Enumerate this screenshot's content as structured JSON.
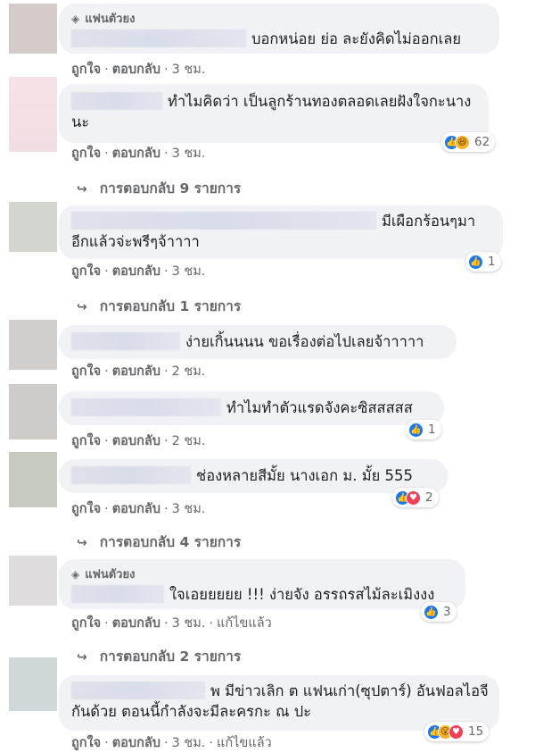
{
  "comments": [
    {
      "badge": "แฟนตัวยง",
      "text": "บอกหน่อย ย่อ ละยังคิดไม่ออกเลย",
      "actions": {
        "like": "ถูกใจ",
        "reply": "ตอบกลับ",
        "time": "3 ชม."
      }
    },
    {
      "text": "ทำไมคิดว่า เป็นลูกร้านทองตลอดเลยฝังใจกะนางนะ",
      "actions": {
        "like": "ถูกใจ",
        "reply": "ตอบกลับ",
        "time": "3 ชม."
      },
      "reactions": {
        "icons": [
          "like-icon",
          "haha-icon"
        ],
        "count": "62"
      },
      "replies": "การตอบกลับ 9 รายการ"
    },
    {
      "text": "มีเผือกร้อนๆมาอีกแล้วจ่ะพรีๆจ้าาาา",
      "actions": {
        "like": "ถูกใจ",
        "reply": "ตอบกลับ",
        "time": "3 ชม."
      },
      "reactions": {
        "icons": [
          "like-icon"
        ],
        "count": "1"
      },
      "replies": "การตอบกลับ 1 รายการ"
    },
    {
      "text": "ง่ายเกิ้นนนน ขอเรื่องต่อไปเลยจ้าาาาา",
      "actions": {
        "like": "ถูกใจ",
        "reply": "ตอบกลับ",
        "time": "2 ชม."
      }
    },
    {
      "text": "ทำไมทำตัวแรดจังคะซิสสสสส",
      "actions": {
        "like": "ถูกใจ",
        "reply": "ตอบกลับ",
        "time": "2 ชม."
      },
      "reactions": {
        "icons": [
          "like-icon"
        ],
        "count": "1"
      }
    },
    {
      "text": "ช่องหลายสีมั้ย นางเอก ม. มั้ย 555",
      "actions": {
        "like": "ถูกใจ",
        "reply": "ตอบกลับ",
        "time": "3 ชม."
      },
      "reactions": {
        "icons": [
          "like-icon",
          "love-icon"
        ],
        "count": "2"
      },
      "replies": "การตอบกลับ 4 รายการ"
    },
    {
      "badge": "แฟนตัวยง",
      "text": "ใจเอยยยยย !!! ง่ายจัง อรรถรสไม้ละเมิงงง",
      "actions": {
        "like": "ถูกใจ",
        "reply": "ตอบกลับ",
        "time": "3 ชม.",
        "edited": "แก้ไขแล้ว"
      },
      "reactions": {
        "icons": [
          "like-icon"
        ],
        "count": "3"
      },
      "replies": "การตอบกลับ 2 รายการ"
    },
    {
      "text": "พ มีข่าวเลิก ต แฟนเก่า(ซุปตาร์) อันฟอลไอจีกันด้วย ตอนนี้กำลังจะมีละครกะ ณ ปะ",
      "actions": {
        "like": "ถูกใจ",
        "reply": "ตอบกลับ",
        "time": "3 ชม.",
        "edited": "แก้ไขแล้ว"
      },
      "reactions": {
        "icons": [
          "like-icon",
          "wow-icon",
          "love-icon"
        ],
        "count": "15"
      }
    }
  ],
  "colors": {
    "like": "#1877f2",
    "love": "#f33e58",
    "haha": "#f7b125",
    "bubble": "#f0f2f5",
    "meta": "#65676b"
  }
}
